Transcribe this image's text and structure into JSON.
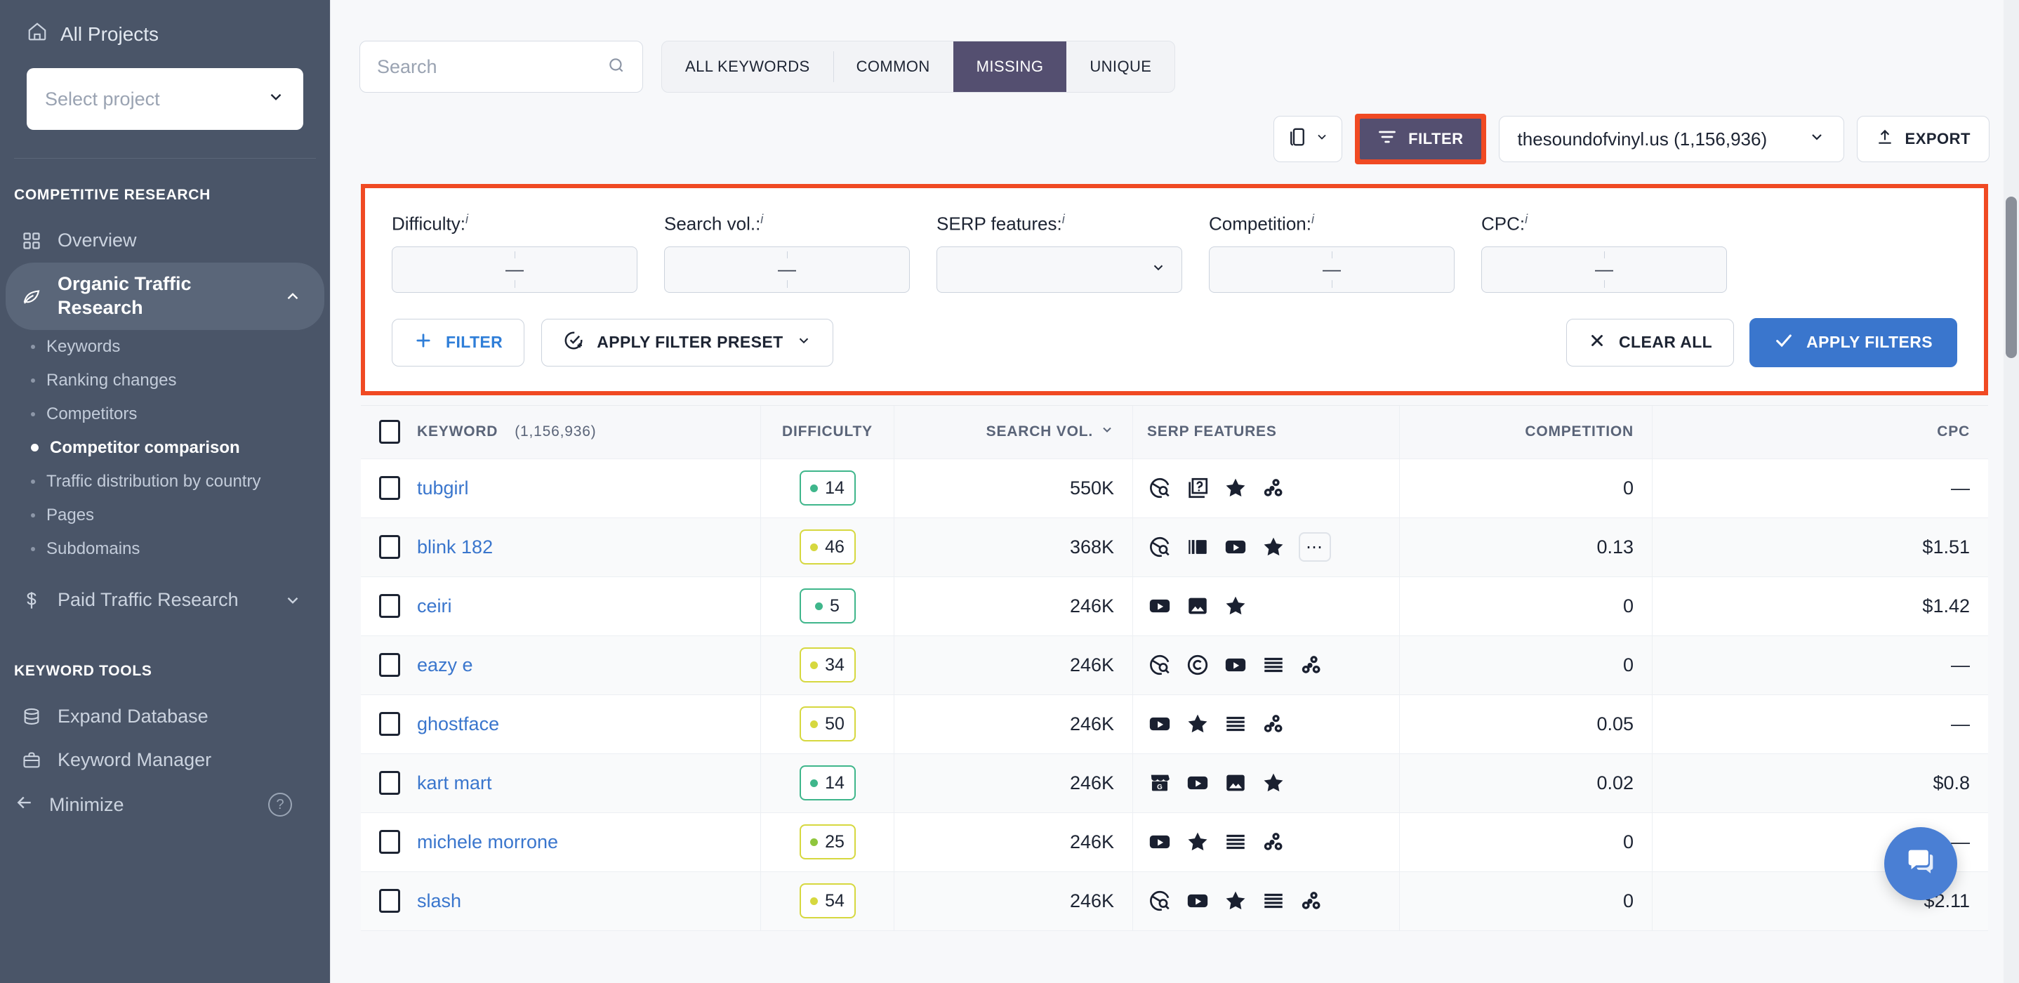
{
  "sidebar": {
    "all_projects": "All Projects",
    "project_select_placeholder": "Select project",
    "sections": [
      {
        "title": "COMPETITIVE RESEARCH",
        "items": [
          {
            "label": "Overview",
            "icon": "grid-icon",
            "type": "item"
          },
          {
            "label": "Organic Traffic Research",
            "icon": "leaf-icon",
            "type": "group",
            "expanded": true,
            "children": [
              {
                "label": "Keywords",
                "selected": false
              },
              {
                "label": "Ranking changes",
                "selected": false
              },
              {
                "label": "Competitors",
                "selected": false
              },
              {
                "label": "Competitor comparison",
                "selected": true
              },
              {
                "label": "Traffic distribution by country",
                "selected": false
              },
              {
                "label": "Pages",
                "selected": false
              },
              {
                "label": "Subdomains",
                "selected": false
              }
            ]
          },
          {
            "label": "Paid Traffic Research",
            "icon": "dollar-icon",
            "type": "group",
            "expanded": false
          }
        ]
      },
      {
        "title": "KEYWORD TOOLS",
        "items": [
          {
            "label": "Expand Database",
            "icon": "database-icon",
            "type": "item"
          },
          {
            "label": "Keyword Manager",
            "icon": "briefcase-icon",
            "type": "item"
          }
        ]
      }
    ],
    "minimize": "Minimize",
    "help": "?"
  },
  "toolbar": {
    "search_placeholder": "Search",
    "tabs": [
      {
        "label": "ALL KEYWORDS",
        "active": false
      },
      {
        "label": "COMMON",
        "active": false
      },
      {
        "label": "MISSING",
        "active": true
      },
      {
        "label": "UNIQUE",
        "active": false
      }
    ],
    "device_toggle_label": "",
    "filter_button": "FILTER",
    "domain_select": "thesoundofvinyl.us (1,156,936)",
    "export_button": "EXPORT"
  },
  "filter_panel": {
    "highlight_color": "#f04a23",
    "fields": [
      {
        "label": "Difficulty:",
        "info": "i",
        "type": "range",
        "value": "—"
      },
      {
        "label": "Search vol.:",
        "info": "i",
        "type": "range",
        "value": "—"
      },
      {
        "label": "SERP features:",
        "info": "i",
        "type": "select",
        "value": ""
      },
      {
        "label": "Competition:",
        "info": "i",
        "type": "range",
        "value": "—"
      },
      {
        "label": "CPC:",
        "info": "i",
        "type": "range",
        "value": "—"
      }
    ],
    "add_filter_button": "FILTER",
    "apply_preset_button": "APPLY FILTER PRESET",
    "clear_all_button": "CLEAR ALL",
    "apply_filters_button": "APPLY FILTERS"
  },
  "table": {
    "columns": [
      {
        "key": "keyword",
        "label": "KEYWORD",
        "count": "(1,156,936)"
      },
      {
        "key": "difficulty",
        "label": "DIFFICULTY"
      },
      {
        "key": "search_vol",
        "label": "SEARCH VOL.",
        "sorted": true
      },
      {
        "key": "serp_features",
        "label": "SERP FEATURES"
      },
      {
        "key": "competition",
        "label": "COMPETITION"
      },
      {
        "key": "cpc",
        "label": "CPC"
      }
    ],
    "rows": [
      {
        "keyword": "tubgirl",
        "difficulty": "14",
        "difficulty_color": "green",
        "search_vol": "550K",
        "serp": [
          "instant-answer-icon",
          "faq-icon",
          "featured-snippet-icon",
          "related-topics-icon"
        ],
        "competition": "0",
        "cpc": "—"
      },
      {
        "keyword": "blink 182",
        "difficulty": "46",
        "difficulty_color": "yellow",
        "search_vol": "368K",
        "serp": [
          "instant-answer-icon",
          "carousel-icon",
          "video-icon",
          "featured-snippet-icon",
          "more-icon"
        ],
        "competition": "0.13",
        "cpc": "$1.51"
      },
      {
        "keyword": "ceiri",
        "difficulty": "5",
        "difficulty_color": "green",
        "search_vol": "246K",
        "serp": [
          "video-icon",
          "image-icon",
          "featured-snippet-icon"
        ],
        "competition": "0",
        "cpc": "$1.42"
      },
      {
        "keyword": "eazy e",
        "difficulty": "34",
        "difficulty_color": "yellow",
        "search_vol": "246K",
        "serp": [
          "instant-answer-icon",
          "copyright-icon",
          "video-icon",
          "text-block-icon",
          "related-topics-icon"
        ],
        "competition": "0",
        "cpc": "—"
      },
      {
        "keyword": "ghostface",
        "difficulty": "50",
        "difficulty_color": "yellow",
        "search_vol": "246K",
        "serp": [
          "video-icon",
          "featured-snippet-icon",
          "text-block-icon",
          "related-topics-icon"
        ],
        "competition": "0.05",
        "cpc": "—"
      },
      {
        "keyword": "kart mart",
        "difficulty": "14",
        "difficulty_color": "green",
        "search_vol": "246K",
        "serp": [
          "local-pack-icon",
          "video-icon",
          "image-icon",
          "featured-snippet-icon"
        ],
        "competition": "0.02",
        "cpc": "$0.8"
      },
      {
        "keyword": "michele morrone",
        "difficulty": "25",
        "difficulty_color": "ygreen",
        "search_vol": "246K",
        "serp": [
          "video-icon",
          "featured-snippet-icon",
          "text-block-icon",
          "related-topics-icon"
        ],
        "competition": "0",
        "cpc": "—"
      },
      {
        "keyword": "slash",
        "difficulty": "54",
        "difficulty_color": "yellow",
        "search_vol": "246K",
        "serp": [
          "instant-answer-icon",
          "video-icon",
          "featured-snippet-icon",
          "text-block-icon",
          "related-topics-icon"
        ],
        "competition": "0",
        "cpc": "$2.11"
      }
    ]
  },
  "chat": {
    "icon": "chat-bubble-icon"
  }
}
